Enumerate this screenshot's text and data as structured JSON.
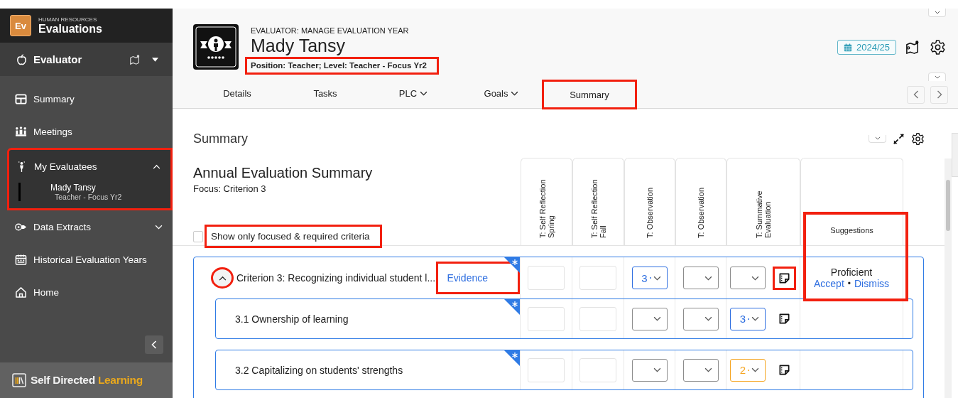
{
  "app": {
    "logo": "Ev",
    "category": "HUMAN RESOURCES",
    "title": "Evaluations"
  },
  "role": {
    "label": "Evaluator"
  },
  "nav": [
    {
      "kind": "link",
      "label": "Summary"
    },
    {
      "kind": "link",
      "label": "Meetings"
    },
    {
      "kind": "group",
      "label": "My Evaluatees",
      "expanded": true,
      "highlighted": true,
      "children": [
        {
          "name": "Mady Tansy",
          "detail": "Teacher - Focus Yr2",
          "selected": true
        }
      ]
    },
    {
      "kind": "group",
      "label": "Data Extracts",
      "expanded": false,
      "highlighted": false
    },
    {
      "kind": "link",
      "label": "Historical Evaluation Years"
    },
    {
      "kind": "link",
      "label": "Home"
    }
  ],
  "brand": {
    "text": "Self Directed",
    "accent": "Learning"
  },
  "header": {
    "eyebrow": "EVALUATOR: MANAGE EVALUATION YEAR",
    "name": "Mady Tansy",
    "position": "Position: Teacher; Level: Teacher - Focus Yr2",
    "position_highlighted": true,
    "year": "2024/25"
  },
  "tabs": [
    {
      "label": "Details",
      "dropdown": false,
      "highlighted": false
    },
    {
      "label": "Tasks",
      "dropdown": false,
      "highlighted": false
    },
    {
      "label": "PLC",
      "dropdown": true,
      "highlighted": false
    },
    {
      "label": "Goals",
      "dropdown": true,
      "highlighted": false
    },
    {
      "label": "Summary",
      "dropdown": false,
      "highlighted": true
    }
  ],
  "section": {
    "title": "Summary"
  },
  "evaluation": {
    "title": "Annual Evaluation Summary",
    "focus": "Focus: Criterion 3",
    "filter": {
      "label": "Show only focused & required criteria",
      "checked": false,
      "highlighted": true
    }
  },
  "columns": [
    {
      "label": "T: Self Reflection Spring"
    },
    {
      "label": "T: Self Reflection Fall"
    },
    {
      "label": "T: Observation"
    },
    {
      "label": "T: Observation"
    },
    {
      "label": "T: Summative Evaluation"
    }
  ],
  "suggestions_column": {
    "label": "Suggestions",
    "highlighted": true
  },
  "criteria": [
    {
      "label": "Criterion 3: Recognizing individual student l...",
      "required": true,
      "expanded": true,
      "toggle_highlighted": true,
      "evidence": "Evidence",
      "evidence_highlighted": true,
      "note_highlighted": true,
      "scores": [
        {
          "kind": "input"
        },
        {
          "kind": "input"
        },
        {
          "kind": "select",
          "value": "3",
          "color": "#2f6fe0"
        },
        {
          "kind": "select",
          "color": "#8c8c8c"
        },
        {
          "kind": "select",
          "color": "#8c8c8c"
        }
      ],
      "suggestion": {
        "rating": "Proficient",
        "accept": "Accept",
        "separator": "•",
        "dismiss": "Dismiss"
      },
      "children": [
        {
          "label": "3.1 Ownership of learning",
          "required": true,
          "note_highlighted": false,
          "scores": [
            {
              "kind": "input"
            },
            {
              "kind": "input"
            },
            {
              "kind": "select",
              "color": "#8c8c8c"
            },
            {
              "kind": "select",
              "color": "#8c8c8c"
            },
            {
              "kind": "select",
              "value": "3",
              "color": "#2f6fe0"
            }
          ]
        },
        {
          "label": "3.2 Capitalizing on students' strengths",
          "required": true,
          "note_highlighted": false,
          "scores": [
            {
              "kind": "input"
            },
            {
              "kind": "input"
            },
            {
              "kind": "select",
              "color": "#8c8c8c"
            },
            {
              "kind": "select",
              "color": "#8c8c8c"
            },
            {
              "kind": "select",
              "value": "2",
              "color": "#f5a623"
            }
          ]
        }
      ]
    }
  ]
}
